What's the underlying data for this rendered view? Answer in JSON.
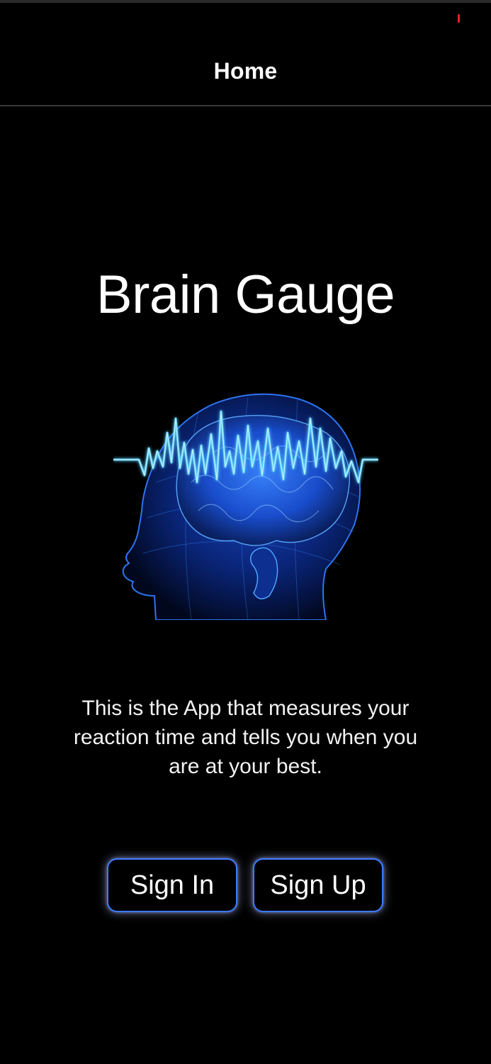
{
  "nav": {
    "title": "Home"
  },
  "main": {
    "app_title": "Brain Gauge",
    "hero_image": "brain-scan-wave-image",
    "description": "This is the App that measures your reaction time and tells you when you are at your best.",
    "buttons": {
      "sign_in": "Sign In",
      "sign_up": "Sign Up"
    }
  },
  "colors": {
    "background": "#000000",
    "text": "#ffffff",
    "button_border": "#3d7bff",
    "accent_glow": "#4fc3ff",
    "status_indicator": "#e02424"
  }
}
